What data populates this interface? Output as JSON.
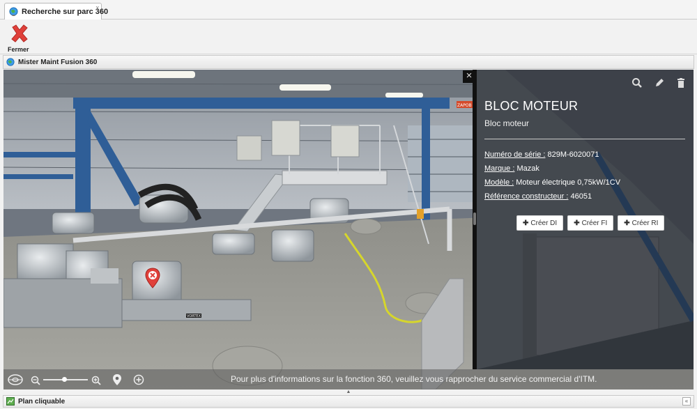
{
  "tab": {
    "label": "Recherche sur parc 360",
    "close_glyph": "x"
  },
  "toolbar": {
    "close_label": "Fermer"
  },
  "panel": {
    "title": "Mister Maint Fusion 360"
  },
  "info": {
    "title": "BLOC MOTEUR",
    "subtitle": "Bloc moteur",
    "rows": [
      {
        "label": "Numéro de série :",
        "value": " 829M-6020071"
      },
      {
        "label": "Marque :",
        "value": " Mazak"
      },
      {
        "label": "Modèle :",
        "value": " Moteur électrique 0,75kW/1CV"
      },
      {
        "label": "Référence constructeur :",
        "value": " 46051"
      }
    ],
    "buttons": [
      {
        "label": "Créer DI"
      },
      {
        "label": "Créer FI"
      },
      {
        "label": "Créer RI"
      }
    ],
    "actions": [
      "search-icon",
      "pencil-icon",
      "trash-icon"
    ]
  },
  "viewer": {
    "close_glyph": "×",
    "message": "Pour plus d'informations sur la fonction 360, veuillez vous rapprocher du service commercial d'ITM.",
    "zoom_level": 0.48,
    "scene_labels": {
      "sign1": "ZAPOB",
      "sign2": "VORTEX"
    }
  },
  "footer": {
    "title": "Plan cliquable",
    "expand_glyph": "«"
  },
  "colors": {
    "accent_red": "#e0403a",
    "panel_dark": "#1e2228",
    "frame_blue": "#2f5e97"
  }
}
